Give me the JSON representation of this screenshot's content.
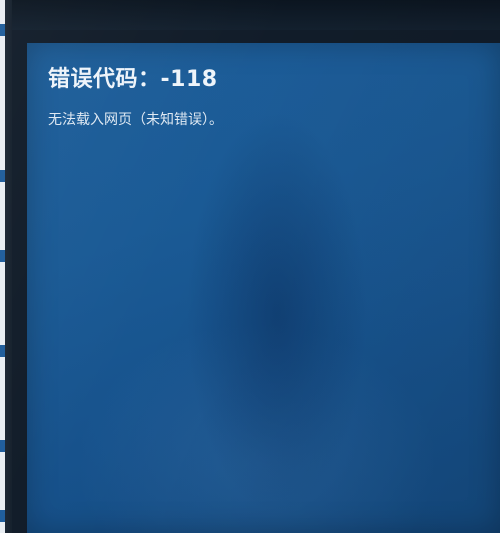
{
  "error": {
    "title": "错误代码：-118",
    "message": "无法载入网页（未知错误）。"
  },
  "colors": {
    "window_background": "#1a5a95",
    "text": "#eef4fa",
    "bezel": "#0d1a28"
  }
}
